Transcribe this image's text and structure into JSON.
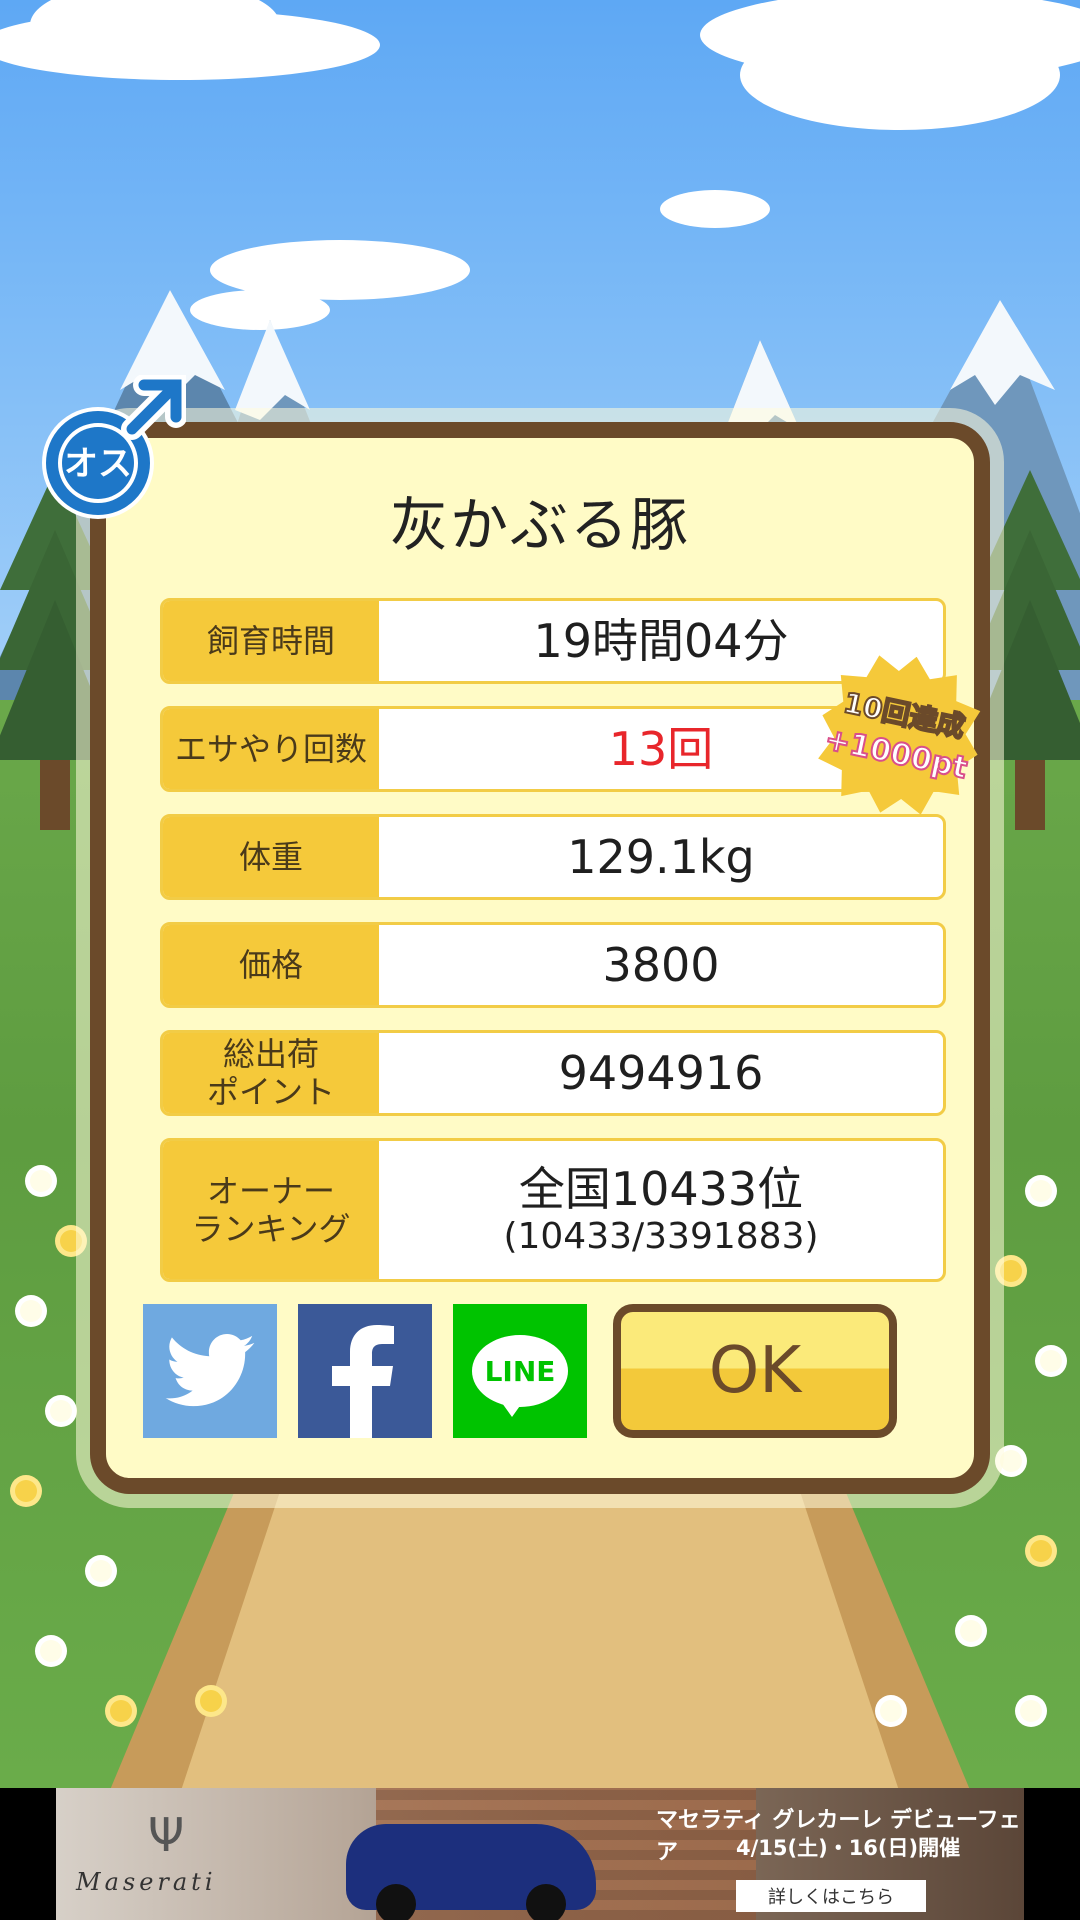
{
  "panel": {
    "title": "灰かぶる豚",
    "gender_badge": "オス",
    "rows": [
      {
        "label": "飼育時間",
        "value": "19時間04分"
      },
      {
        "label": "エサやり回数",
        "value": "13回"
      },
      {
        "label": "体重",
        "value": "129.1kg"
      },
      {
        "label": "価格",
        "value": "3800"
      },
      {
        "label": "総出荷\nポイント",
        "value": "9494916"
      },
      {
        "label": "オーナー\nランキング",
        "value": "全国10433位",
        "sub": "(10433/3391883)"
      }
    ],
    "achievement": {
      "line1": "10回達成",
      "line2": "+1000pt"
    }
  },
  "share": {
    "line_label": "LINE",
    "ok_label": "OK"
  },
  "ad": {
    "brand": "Maserati",
    "title": "マセラティ グレカーレ デビューフェア",
    "date": "4/15(土)・16(日)開催",
    "cta": "詳しくはこちら"
  },
  "colors": {
    "panel_border": "#6b4a2a",
    "panel_bg": "#fffbc6",
    "label_bg": "#f5c93a",
    "highlight": "#e8262b"
  }
}
